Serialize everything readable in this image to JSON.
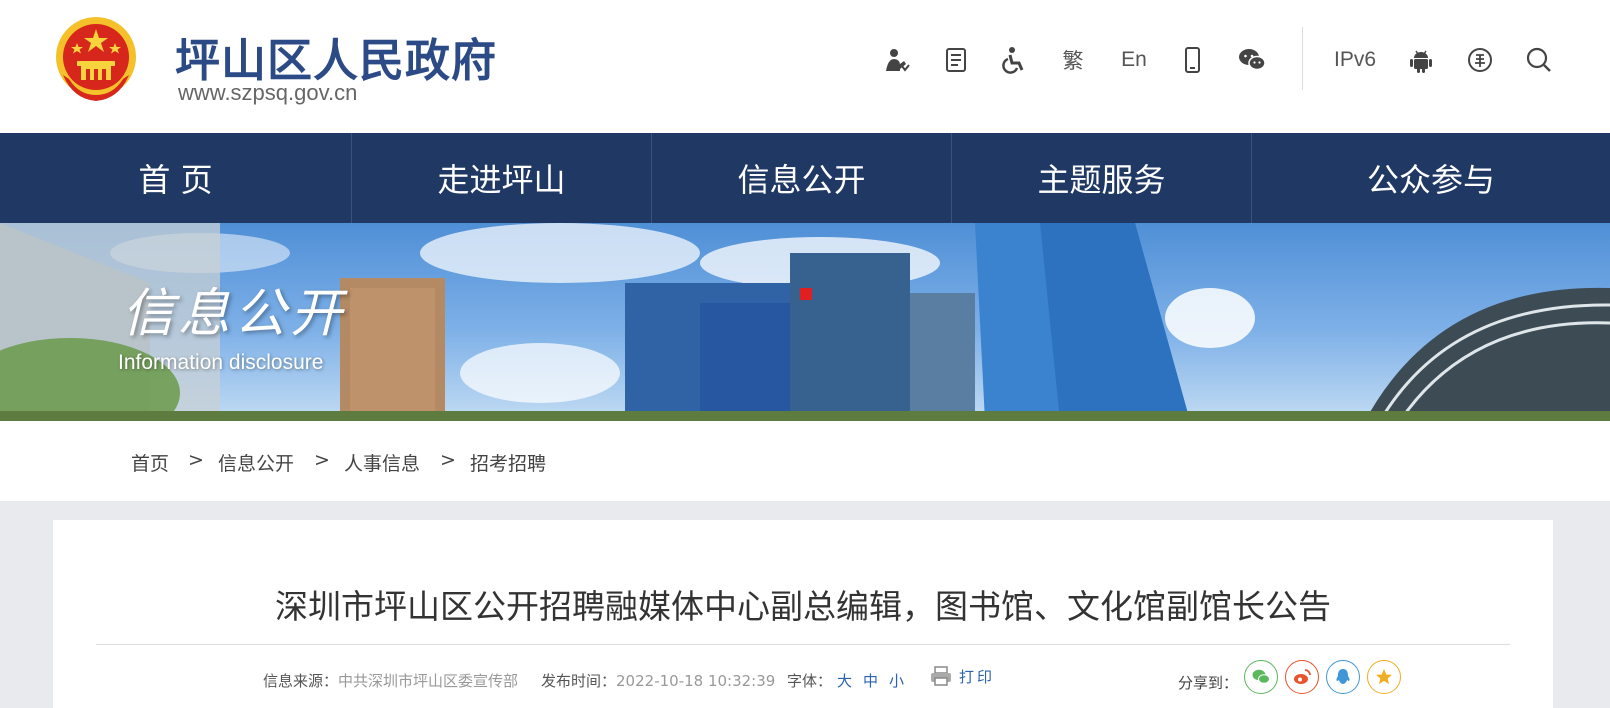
{
  "header": {
    "title": "坪山区人民政府",
    "url": "www.szpsq.gov.cn",
    "tools": [
      {
        "name": "elder-care-icon",
        "label": ""
      },
      {
        "name": "document-icon",
        "label": ""
      },
      {
        "name": "accessibility-icon",
        "label": ""
      },
      {
        "name": "traditional-chinese-button",
        "label": "繁"
      },
      {
        "name": "english-button",
        "label": "En"
      },
      {
        "name": "mobile-icon",
        "label": ""
      },
      {
        "name": "wechat-icon",
        "label": ""
      },
      {
        "name": "ipv6-badge",
        "label": "IPv6"
      },
      {
        "name": "android-icon",
        "label": ""
      },
      {
        "name": "currency-icon",
        "label": ""
      },
      {
        "name": "search-icon",
        "label": ""
      }
    ]
  },
  "nav": {
    "items": [
      "首 页",
      "走进坪山",
      "信息公开",
      "主题服务",
      "公众参与"
    ]
  },
  "banner": {
    "title": "信息公开",
    "subtitle": "Information disclosure"
  },
  "breadcrumb": {
    "items": [
      "首页",
      "信息公开",
      "人事信息",
      "招考招聘"
    ],
    "separator": ">"
  },
  "article": {
    "title": "深圳市坪山区公开招聘融媒体中心副总编辑，图书馆、文化馆副馆长公告",
    "source_label": "信息来源：",
    "source_value": "中共深圳市坪山区委宣传部",
    "time_label": "发布时间：",
    "time_value": "2022-10-18 10:32:39",
    "font_label": "字体：",
    "font_sizes": [
      "大",
      "中",
      "小"
    ],
    "print_label": "打印",
    "share_label": "分享到："
  },
  "colors": {
    "nav_bg": "#1f3864",
    "title_blue": "#2b4a86",
    "link_blue": "#2b63b3",
    "wechat": "#5cb85c",
    "weibo": "#e6532c",
    "qq": "#3f97d8",
    "qzone": "#f0ad1f"
  }
}
